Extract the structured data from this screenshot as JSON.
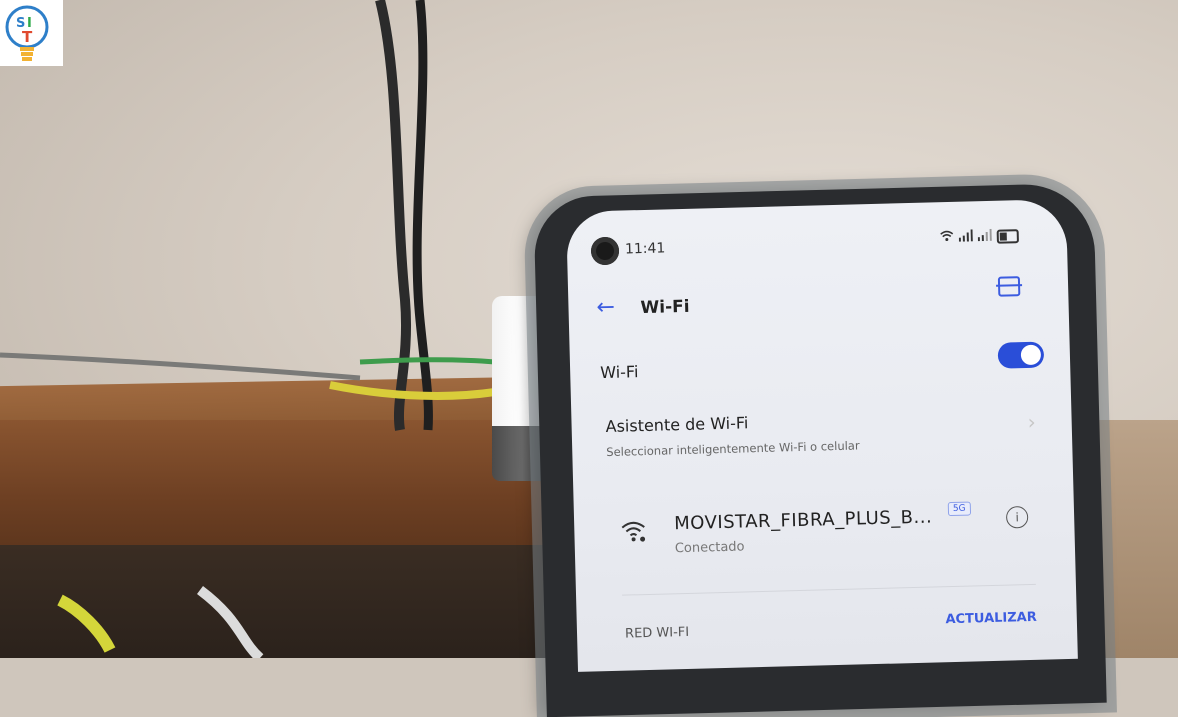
{
  "logo": {
    "text": "SI T"
  },
  "phone": {
    "status_bar": {
      "time": "11:41"
    },
    "header": {
      "title": "Wi-Fi",
      "back_icon": "arrow-left-icon",
      "scan_icon": "scan-qr-icon"
    },
    "wifi_toggle": {
      "label": "Wi-Fi",
      "on": true
    },
    "assistant": {
      "title": "Asistente de Wi-Fi",
      "subtitle": "Seleccionar inteligentemente Wi-Fi o celular"
    },
    "connected_network": {
      "name": "MOVISTAR_FIBRA_PLUS_B...",
      "badge": "5G",
      "status": "Conectado"
    },
    "section": {
      "label": "RED WI-FI",
      "action": "ACTUALIZAR"
    },
    "colors": {
      "accent": "#2a4ed8"
    }
  }
}
